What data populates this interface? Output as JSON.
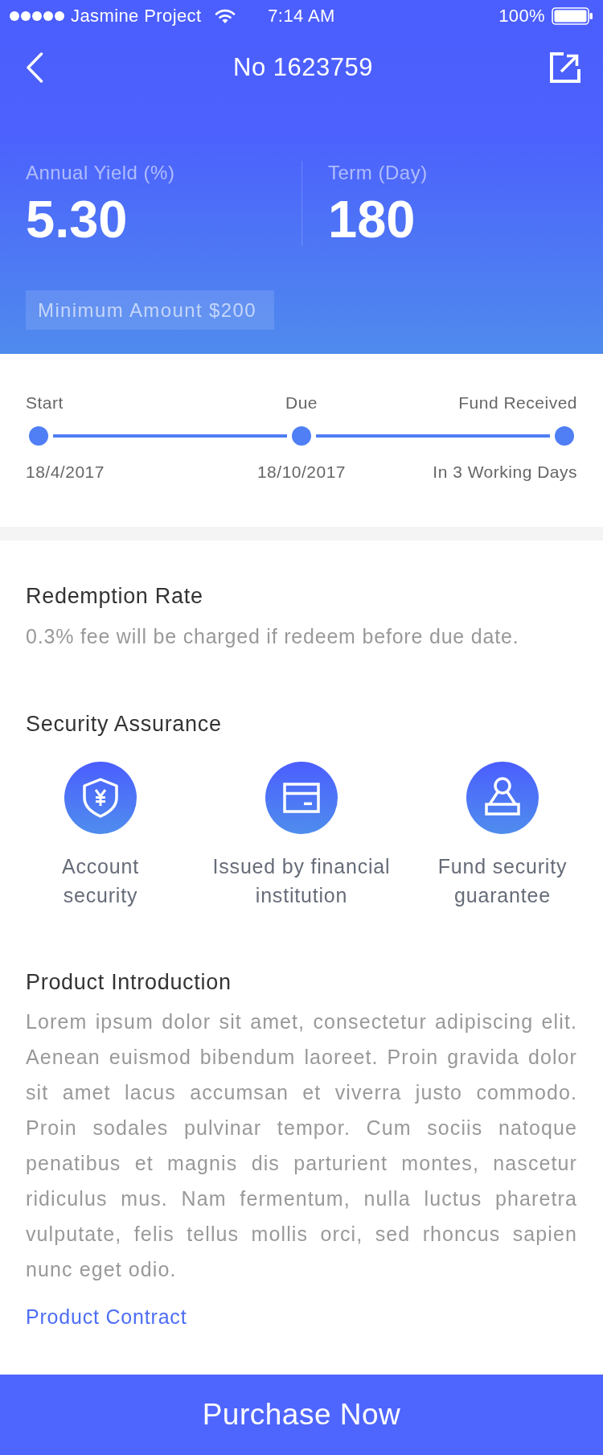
{
  "status_bar": {
    "carrier": "Jasmine Project",
    "time": "7:14 AM",
    "battery": "100%"
  },
  "nav_bar": {
    "title": "No 1623759"
  },
  "summary": {
    "stats": [
      {
        "label": "Annual Yield (%)",
        "value": "5.30"
      },
      {
        "label": "Term (Day)",
        "value": "180"
      }
    ],
    "minimum_amount": "Minimum Amount $200"
  },
  "timeline": [
    {
      "label": "Start",
      "date": "18/4/2017"
    },
    {
      "label": "Due",
      "date": "18/10/2017"
    },
    {
      "label": "Fund Received",
      "date": "In 3 Working Days"
    }
  ],
  "redemption": {
    "title": "Redemption Rate",
    "text": "0.3% fee will be charged if redeem before due date."
  },
  "security": {
    "title": "Security Assurance",
    "items": [
      {
        "kind": "shield",
        "label": "Account\nsecurity"
      },
      {
        "kind": "card",
        "label": "Issued by financial\ninstitution"
      },
      {
        "kind": "stamp",
        "label": "Fund security\nguarantee"
      }
    ]
  },
  "introduction": {
    "title": "Product Introduction",
    "text": "Lorem ipsum dolor sit amet, consectetur adipiscing elit. Aenean euismod bibendum laoreet. Proin gravida dolor sit amet lacus accumsan et viverra justo commodo. Proin sodales pulvinar tempor. Cum sociis natoque penatibus et magnis dis parturient montes, nascetur ridiculus mus. Nam fermentum, nulla luctus pharetra vulputate, felis tellus mollis orci, sed rhoncus sapien nunc eget odio.",
    "link": "Product Contract"
  },
  "purchase_button": "Purchase Now"
}
